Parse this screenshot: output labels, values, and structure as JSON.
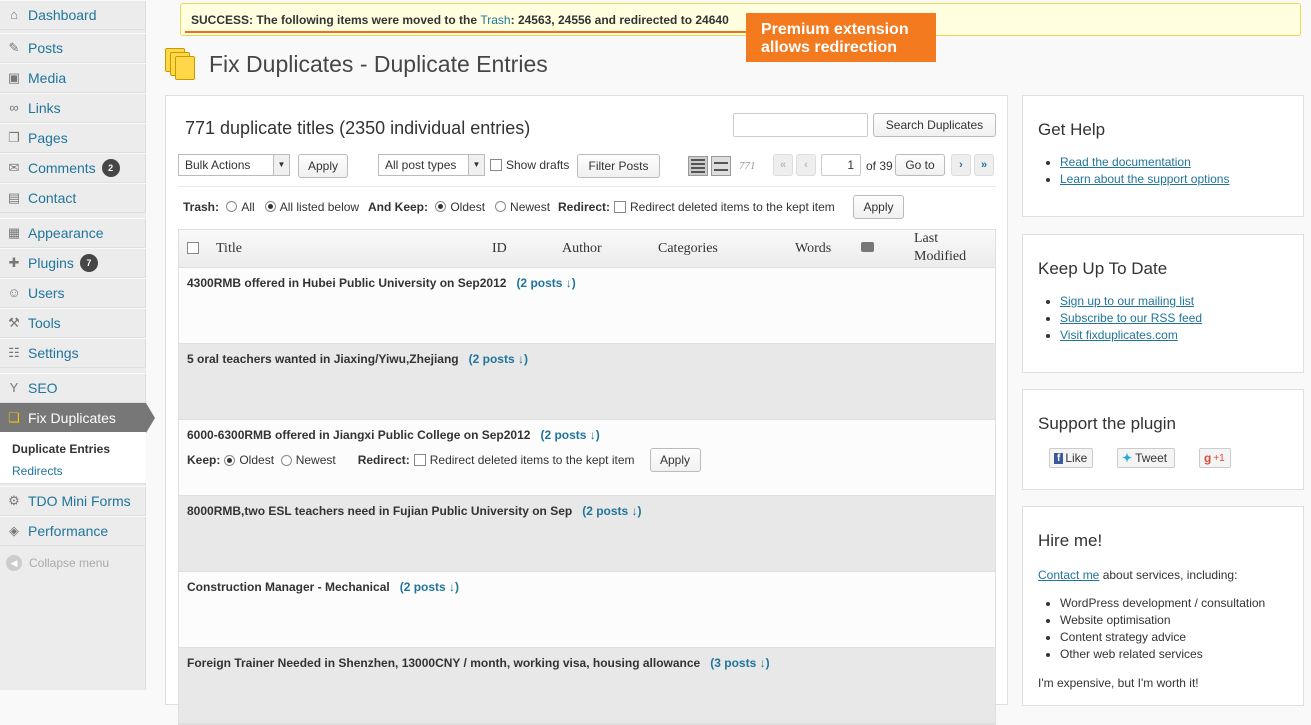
{
  "sidebar": {
    "items": [
      {
        "label": "Dashboard",
        "icon": "dashboard-icon",
        "glyph": "⌂"
      },
      {
        "label": "Posts",
        "icon": "pin-icon",
        "glyph": "✎"
      },
      {
        "label": "Media",
        "icon": "media-icon",
        "glyph": "▣"
      },
      {
        "label": "Links",
        "icon": "link-icon",
        "glyph": "∞"
      },
      {
        "label": "Pages",
        "icon": "pages-icon",
        "glyph": "❐"
      },
      {
        "label": "Comments",
        "icon": "comment-icon",
        "glyph": "✉",
        "badge": "2"
      },
      {
        "label": "Contact",
        "icon": "contact-icon",
        "glyph": "▤"
      },
      {
        "label": "Appearance",
        "icon": "appearance-icon",
        "glyph": "▦"
      },
      {
        "label": "Plugins",
        "icon": "plugin-icon",
        "glyph": "✚",
        "badge": "7"
      },
      {
        "label": "Users",
        "icon": "users-icon",
        "glyph": "☺"
      },
      {
        "label": "Tools",
        "icon": "tools-icon",
        "glyph": "⚒"
      },
      {
        "label": "Settings",
        "icon": "settings-icon",
        "glyph": "☷"
      },
      {
        "label": "SEO",
        "icon": "seo-icon",
        "glyph": "Y"
      },
      {
        "label": "Fix Duplicates",
        "icon": "fix-duplicates-icon",
        "glyph": "❏"
      },
      {
        "label": "TDO Mini Forms",
        "icon": "forms-icon",
        "glyph": "⚙"
      },
      {
        "label": "Performance",
        "icon": "performance-icon",
        "glyph": "◈"
      }
    ],
    "submenu": {
      "current": "Duplicate Entries",
      "other": "Redirects"
    },
    "collapse": "Collapse menu"
  },
  "notice": {
    "prefix": "SUCCESS: The following items were moved to the ",
    "link": "Trash",
    "suffix": ": 24563, 24556 and redirected to 24640"
  },
  "callout": {
    "line1": "Premium extension",
    "line2": "allows redirection"
  },
  "page_title": "Fix Duplicates - Duplicate Entries",
  "main": {
    "count_heading": "771 duplicate titles (2350 individual entries)",
    "search_value": "",
    "search_button": "Search Duplicates",
    "bulk_actions": "Bulk Actions",
    "apply": "Apply",
    "post_types": "All post types",
    "show_drafts": "Show drafts",
    "filter_posts": "Filter Posts",
    "items_count": "771",
    "first": "«",
    "prev": "‹",
    "page_value": "1",
    "of_pages": "of 39",
    "go_to": "Go to",
    "next": "›",
    "last": "»",
    "trash_label": "Trash:",
    "trash_all": "All",
    "trash_listed": "All listed below",
    "keep_label": "And Keep:",
    "keep_oldest": "Oldest",
    "keep_newest": "Newest",
    "redirect_label": "Redirect:",
    "redirect_text": "Redirect deleted items to the kept item",
    "apply2": "Apply"
  },
  "table": {
    "columns": {
      "title": "Title",
      "id": "ID",
      "author": "Author",
      "categories": "Categories",
      "words": "Words",
      "modified1": "Last",
      "modified2": "Modified"
    },
    "rows": [
      {
        "title": "4300RMB offered in Hubei Public University on Sep2012",
        "posts": "(2 posts ↓)"
      },
      {
        "title": "5 oral teachers wanted in Jiaxing/Yiwu,Zhejiang",
        "posts": "(2 posts ↓)"
      },
      {
        "title": "6000-6300RMB offered in Jiangxi Public College on Sep2012",
        "posts": "(2 posts ↓)"
      },
      {
        "title": "8000RMB,two ESL teachers need in Fujian Public University on Sep",
        "posts": "(2 posts ↓)"
      },
      {
        "title": "Construction Manager - Mechanical",
        "posts": "(2 posts ↓)"
      },
      {
        "title": "Foreign Trainer Needed in Shenzhen, 13000CNY / month, working visa, housing allowance",
        "posts": "(3 posts ↓)"
      }
    ],
    "row_keep": {
      "keep": "Keep:",
      "oldest": "Oldest",
      "newest": "Newest",
      "redirect": "Redirect:",
      "redirect_text": "Redirect deleted items to the kept item",
      "apply": "Apply"
    }
  },
  "widgets": {
    "help": {
      "title": "Get Help",
      "links": [
        "Read the documentation",
        "Learn about the support options"
      ]
    },
    "uptodate": {
      "title": "Keep Up To Date",
      "links": [
        "Sign up to our mailing list",
        "Subscribe to our RSS feed",
        "Visit fixduplicates.com"
      ]
    },
    "support": {
      "title": "Support the plugin",
      "like": "Like",
      "tweet": "Tweet",
      "plusone": "+1"
    },
    "hire": {
      "title": "Hire me!",
      "contact_link": "Contact me",
      "contact_rest": " about services, including:",
      "services": [
        "WordPress development / consultation",
        "Website optimisation",
        "Content strategy advice",
        "Other web related services"
      ],
      "footer": "I'm expensive, but I'm worth it!"
    }
  }
}
